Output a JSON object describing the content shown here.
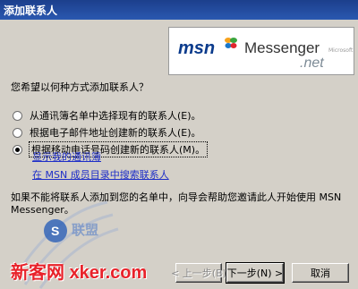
{
  "window": {
    "title": "添加联系人"
  },
  "logo": {
    "brand": "msn",
    "product": "Messenger",
    "suffix": ".net",
    "vendor": "Microsoft"
  },
  "question": "您希望以何种方式添加联系人？",
  "options": [
    {
      "label": "从通讯簿名单中选择现有的联系人(E)。",
      "selected": false
    },
    {
      "label": "根据电子邮件地址创建新的联系人(E)。",
      "selected": false
    },
    {
      "label": "根据移动电话号码创建新的联系人(M)。",
      "selected": true
    }
  ],
  "links": {
    "show_address_book": "显示我的通讯簿",
    "search_directory": "在 MSN 成员目录中搜索联系人"
  },
  "info_text": "如果不能将联系人添加到您的名单中，向导会帮助您邀请此人开始使用 MSN Messenger。",
  "buttons": {
    "back": "< 上一步(B)",
    "next": "下一步(N) >",
    "cancel": "取消"
  },
  "watermark": {
    "text": "新客网 xker.com",
    "badge": "S",
    "badge_text": "联盟"
  },
  "colors": {
    "titlebar": "#2a58b0",
    "link": "#1e2ec8",
    "watermark": "#e8222a",
    "dialog_bg": "#d4d0c8"
  }
}
